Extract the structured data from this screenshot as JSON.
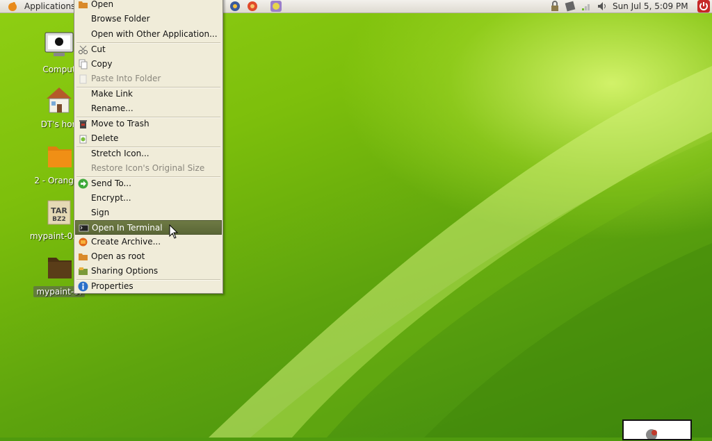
{
  "panel": {
    "applications_label": "Applications",
    "clock": "Sun Jul  5,  5:09 PM"
  },
  "desktop_icons": [
    {
      "label": "Comput"
    },
    {
      "label": "DT's hon"
    },
    {
      "label": "2 - Orange I"
    },
    {
      "label": "mypaint-0.7.0"
    },
    {
      "label": "mypaint-0."
    }
  ],
  "tar_icon_text": {
    "line1": "TAR",
    "line2": "BZ2"
  },
  "menu": {
    "items": [
      {
        "label": "Open",
        "icon": "folder-icon"
      },
      {
        "label": "Browse Folder"
      },
      {
        "label": "Open with Other Application..."
      },
      {
        "label": "Cut",
        "icon": "scissors-icon"
      },
      {
        "label": "Copy",
        "icon": "copy-icon"
      },
      {
        "label": "Paste Into Folder",
        "icon": "paste-icon",
        "disabled": true
      },
      {
        "label": "Make Link"
      },
      {
        "label": "Rename..."
      },
      {
        "label": "Move to Trash",
        "icon": "trash-icon"
      },
      {
        "label": "Delete",
        "icon": "delete-icon"
      },
      {
        "label": "Stretch Icon..."
      },
      {
        "label": "Restore Icon's Original Size",
        "disabled": true
      },
      {
        "label": "Send To...",
        "icon": "send-icon"
      },
      {
        "label": "Encrypt..."
      },
      {
        "label": "Sign"
      },
      {
        "label": "Open In Terminal",
        "icon": "terminal-icon",
        "highlighted": true
      },
      {
        "label": "Create Archive...",
        "icon": "archive-icon"
      },
      {
        "label": "Open as root",
        "icon": "folder-root-icon"
      },
      {
        "label": "Sharing Options",
        "icon": "sharing-icon"
      },
      {
        "label": "Properties",
        "icon": "info-icon"
      }
    ]
  },
  "colors": {
    "menu_bg": "#f0ecd9",
    "highlight": "#5a6636",
    "wallpaper": "#7dbf0c"
  }
}
